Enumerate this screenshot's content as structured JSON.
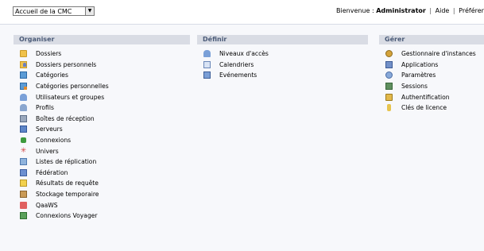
{
  "header": {
    "nav_select": {
      "value": "Accueil de la CMC"
    },
    "welcome": "Bienvenue :",
    "user": "Administrator",
    "separator": "|",
    "help": "Aide",
    "preferences": "Préférences"
  },
  "panels": {
    "organiser": {
      "title": "Organiser",
      "items": [
        {
          "label": "Dossiers",
          "icon": "folder-icon"
        },
        {
          "label": "Dossiers personnels",
          "icon": "personal-folder-icon"
        },
        {
          "label": "Catégories",
          "icon": "category-icon"
        },
        {
          "label": "Catégories personnelles",
          "icon": "personal-category-icon"
        },
        {
          "label": "Utilisateurs et groupes",
          "icon": "users-groups-icon"
        },
        {
          "label": "Profils",
          "icon": "profile-icon"
        },
        {
          "label": "Boîtes de réception",
          "icon": "inbox-icon"
        },
        {
          "label": "Serveurs",
          "icon": "server-icon"
        },
        {
          "label": "Connexions",
          "icon": "connection-icon"
        },
        {
          "label": "Univers",
          "icon": "universe-icon"
        },
        {
          "label": "Listes de réplication",
          "icon": "replication-icon"
        },
        {
          "label": "Fédération",
          "icon": "federation-icon"
        },
        {
          "label": "Résultats de requête",
          "icon": "query-results-icon"
        },
        {
          "label": "Stockage temporaire",
          "icon": "temp-storage-icon"
        },
        {
          "label": "QaaWS",
          "icon": "qaaws-icon"
        },
        {
          "label": "Connexions Voyager",
          "icon": "voyager-icon"
        }
      ]
    },
    "definir": {
      "title": "Définir",
      "items": [
        {
          "label": "Niveaux d'accès",
          "icon": "access-level-icon"
        },
        {
          "label": "Calendriers",
          "icon": "calendar-icon"
        },
        {
          "label": "Evénements",
          "icon": "event-icon"
        }
      ]
    },
    "gerer": {
      "title": "Gérer",
      "items": [
        {
          "label": "Gestionnaire d'instances",
          "icon": "instance-manager-icon"
        },
        {
          "label": "Applications",
          "icon": "applications-icon"
        },
        {
          "label": "Paramètres",
          "icon": "settings-icon"
        },
        {
          "label": "Sessions",
          "icon": "sessions-icon"
        },
        {
          "label": "Authentification",
          "icon": "lock-icon"
        },
        {
          "label": "Clés de licence",
          "icon": "license-key-icon"
        }
      ]
    }
  }
}
